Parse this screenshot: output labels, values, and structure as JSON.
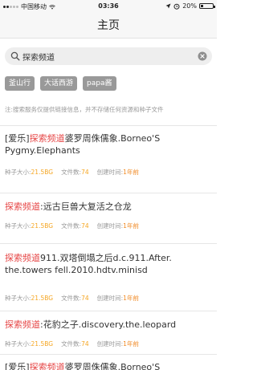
{
  "status_bar": {
    "carrier": "中国移动",
    "time": "03:36",
    "battery_text": "20%",
    "battery_level": 0.2
  },
  "nav": {
    "title": "主页"
  },
  "search": {
    "value": "探索频道",
    "placeholder": ""
  },
  "tags": [
    "釜山行",
    "大话西游",
    "papa酱"
  ],
  "notice": "注:搜索服务仅提供链接信息，并不存储任何资源和种子文件",
  "meta_labels": {
    "size": "种子大小:",
    "count": "文件数:",
    "time": "创建时间:"
  },
  "results": [
    {
      "prefix": "[爱乐]",
      "highlight": "探索频道",
      "rest": "婆罗周侏儒象.Borneo'S Pygmy.Elephants",
      "size": "21.5BG",
      "count": "74",
      "time": "1年前"
    },
    {
      "prefix": "",
      "highlight": "探索频道",
      "rest": ":远古巨兽大复活之仓龙",
      "size": "21.5BG",
      "count": "74",
      "time": "1年前"
    },
    {
      "prefix": "",
      "highlight": "探索频道",
      "rest": "911.双塔倒塌之后d.c.911.After. the.towers fell.2010.hdtv.minisd",
      "size": "21.5BG",
      "count": "74",
      "time": "1年前"
    },
    {
      "prefix": "",
      "highlight": "探索频道",
      "rest": ":花豹之子.discovery.the.leopard",
      "size": "21.5BG",
      "count": "74",
      "time": "1年前"
    },
    {
      "prefix": "[爱乐]",
      "highlight": "探索频道",
      "rest": "婆罗周侏儒象.Borneo'S",
      "size": "",
      "count": "",
      "time": ""
    }
  ]
}
